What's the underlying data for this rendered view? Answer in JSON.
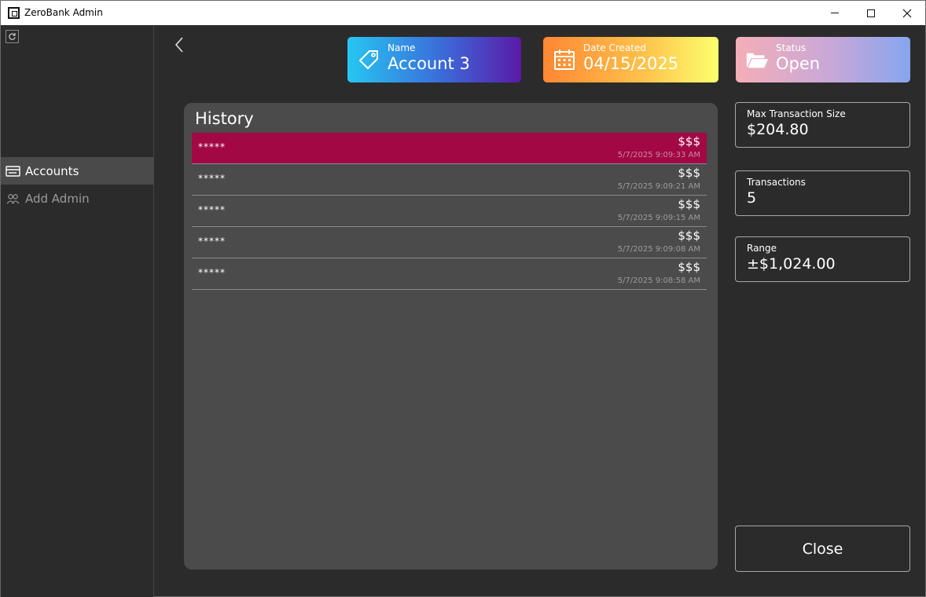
{
  "window": {
    "title": "ZeroBank Admin"
  },
  "sidebar": {
    "items": [
      {
        "label": "Accounts",
        "icon": "card-icon",
        "selected": true
      },
      {
        "label": "Add Admin",
        "icon": "users-icon",
        "selected": false
      }
    ]
  },
  "header_cards": {
    "name": {
      "label": "Name",
      "value": "Account 3",
      "icon": "tag-icon"
    },
    "date_created": {
      "label": "Date Created",
      "value": "04/15/2025",
      "icon": "calendar-icon"
    },
    "status": {
      "label": "Status",
      "value": "Open",
      "icon": "folder-open-icon"
    }
  },
  "history": {
    "title": "History",
    "rows": [
      {
        "description": "*****",
        "amount": "$$$",
        "timestamp": "5/7/2025 9:09:33 AM",
        "selected": true
      },
      {
        "description": "*****",
        "amount": "$$$",
        "timestamp": "5/7/2025 9:09:21 AM",
        "selected": false
      },
      {
        "description": "*****",
        "amount": "$$$",
        "timestamp": "5/7/2025 9:09:15 AM",
        "selected": false
      },
      {
        "description": "*****",
        "amount": "$$$",
        "timestamp": "5/7/2025 9:09:08 AM",
        "selected": false
      },
      {
        "description": "*****",
        "amount": "$$$",
        "timestamp": "5/7/2025 9:08:58 AM",
        "selected": false
      }
    ]
  },
  "stats": {
    "max_transaction": {
      "label": "Max Transaction Size",
      "value": "$204.80"
    },
    "transactions": {
      "label": "Transactions",
      "value": "5"
    },
    "range": {
      "label": "Range",
      "value": "±$1,024.00"
    }
  },
  "close_label": "Close",
  "colors": {
    "background": "#2b2b2b",
    "panel": "#4b4b4b",
    "selected_row": "#a20844",
    "nav_selected": "#4a4a4a"
  }
}
